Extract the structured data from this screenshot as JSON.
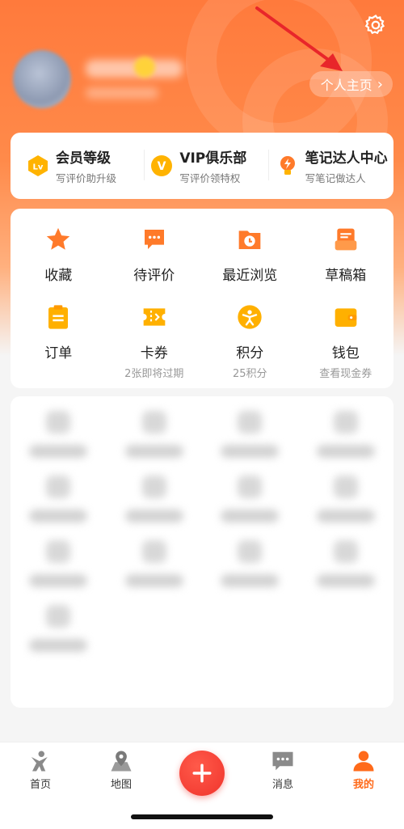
{
  "colors": {
    "accent": "#ff7a3c",
    "active_tab": "#ff6a1a",
    "plus_button": "#f0342c",
    "icon_orange": "#ff7a2a",
    "icon_yellow": "#ffb000"
  },
  "header": {
    "settings_icon": "gear-icon",
    "profile_button_label": "个人主页",
    "profile_button_chevron": "›"
  },
  "member": {
    "items": [
      {
        "icon": "level-badge-icon",
        "badge": "Lv",
        "title": "会员等级",
        "subtitle": "写评价助升级"
      },
      {
        "icon": "vip-badge-icon",
        "badge": "V",
        "title": "VIP俱乐部",
        "subtitle": "写评价领特权"
      },
      {
        "icon": "note-expert-icon",
        "title": "笔记达人中心",
        "subtitle": "写笔记做达人"
      }
    ]
  },
  "quick": {
    "items": [
      {
        "icon": "star-icon",
        "label": "收藏",
        "sub": ""
      },
      {
        "icon": "comment-icon",
        "label": "待评价",
        "sub": ""
      },
      {
        "icon": "history-icon",
        "label": "最近浏览",
        "sub": ""
      },
      {
        "icon": "draft-icon",
        "label": "草稿箱",
        "sub": ""
      },
      {
        "icon": "order-icon",
        "label": "订单",
        "sub": ""
      },
      {
        "icon": "coupon-icon",
        "label": "卡券",
        "sub": "2张即将过期"
      },
      {
        "icon": "points-icon",
        "label": "积分",
        "sub": "25积分"
      },
      {
        "icon": "wallet-icon",
        "label": "钱包",
        "sub": "查看现金券"
      }
    ]
  },
  "tabbar": {
    "items": [
      {
        "icon": "home-icon",
        "label": "首页"
      },
      {
        "icon": "map-icon",
        "label": "地图"
      },
      {
        "icon": "plus-icon",
        "label": ""
      },
      {
        "icon": "message-icon",
        "label": "消息"
      },
      {
        "icon": "profile-icon",
        "label": "我的"
      }
    ],
    "active": "我的"
  }
}
